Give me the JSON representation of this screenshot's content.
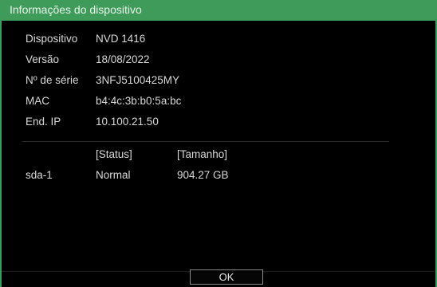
{
  "window": {
    "title": "Informações do dispositivo"
  },
  "info": [
    {
      "label": "Dispositivo",
      "value": "NVD 1416"
    },
    {
      "label": "Versão",
      "value": "18/08/2022"
    },
    {
      "label": "Nº de série",
      "value": "3NFJ5100425MY"
    },
    {
      "label": "MAC",
      "value": "b4:4c:3b:b0:5a:bc"
    },
    {
      "label": "End. IP",
      "value": "10.100.21.50"
    }
  ],
  "disk_table": {
    "headers": {
      "status": "[Status]",
      "size": "[Tamanho]"
    },
    "rows": [
      {
        "name": "sda-1",
        "status": "Normal",
        "size": "904.27 GB"
      }
    ]
  },
  "buttons": {
    "ok": "OK"
  },
  "colors": {
    "accent": "#3e9b59",
    "background": "#000000",
    "text": "#d8d8d8"
  }
}
